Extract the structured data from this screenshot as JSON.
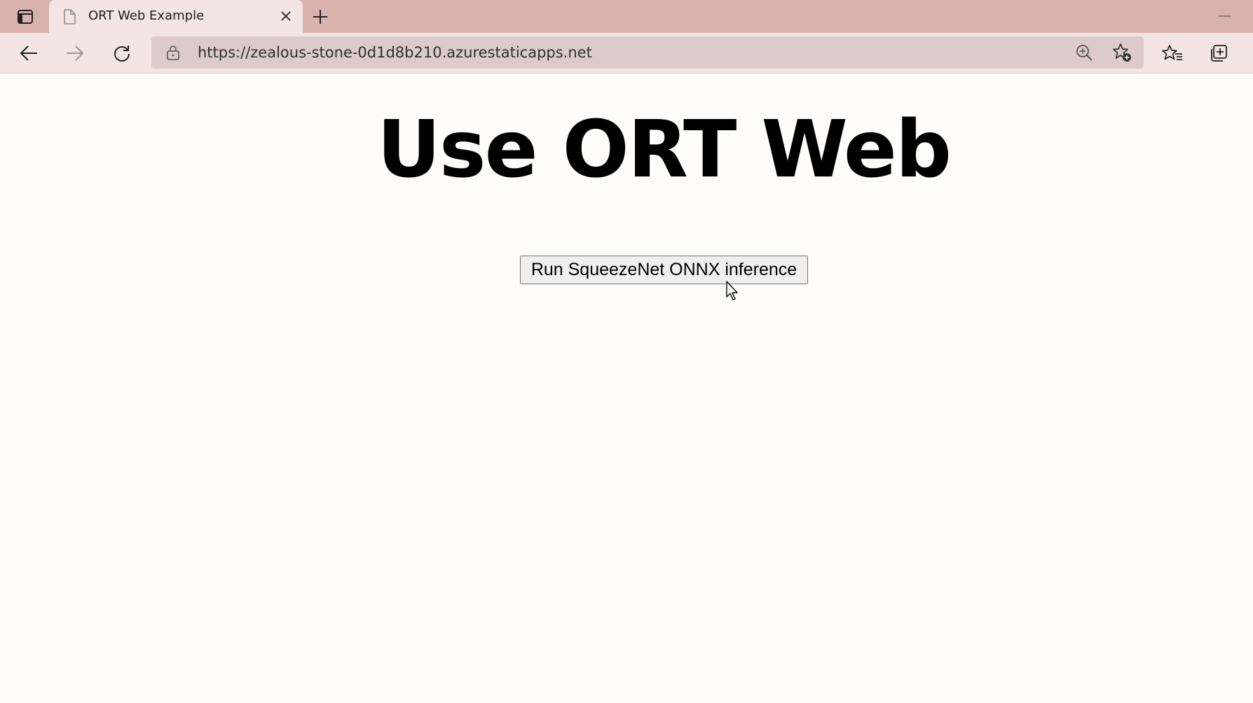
{
  "browser": {
    "tab": {
      "title": "ORT Web Example",
      "favicon": "document-icon"
    },
    "address_bar": {
      "url": "https://zealous-stone-0d1d8b210.azurestaticapps.net"
    },
    "icons": {
      "tab_actions": "tab-actions-icon",
      "tab_close": "close-icon",
      "new_tab": "plus-icon",
      "minimize": "minimize-icon",
      "back": "back-arrow-icon",
      "forward": "forward-arrow-icon",
      "refresh": "refresh-icon",
      "lock": "lock-icon",
      "zoom": "zoom-in-icon",
      "add_favorite": "add-favorite-icon",
      "favorites": "favorites-icon",
      "collections": "collections-icon"
    },
    "colors": {
      "tabstrip_bg": "#d9b2ad",
      "toolbar_bg": "#f2e5e3",
      "address_bg": "#dccbca"
    }
  },
  "page": {
    "heading": "Use ORT Web",
    "run_button_label": "Run SqueezeNet ONNX inference"
  }
}
